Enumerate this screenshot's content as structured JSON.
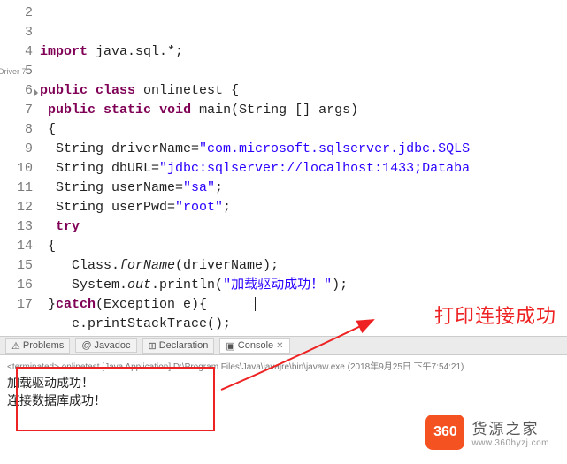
{
  "gutter": {
    "lines": [
      "2",
      "3",
      "4",
      "5",
      "6",
      "7",
      "8",
      "9",
      "10",
      "11",
      "12",
      "13",
      "14",
      "15",
      "16",
      "17"
    ],
    "override_marker": "6"
  },
  "left_label": "Driver 7",
  "code": {
    "l3_kw": "import",
    "l3_rest": " java.sql.*;",
    "l5_kw1": "public",
    "l5_kw2": "class",
    "l5_rest": " onlinetest {",
    "l6_kw1": "public",
    "l6_kw2": "static",
    "l6_kw3": "void",
    "l6_rest": " main(String [] args)",
    "l7": " {",
    "l8a": "  String driverName=",
    "l8b": "\"com.microsoft.sqlserver.jdbc.SQLS",
    "l9a": "  String dbURL=",
    "l9b": "\"jdbc:sqlserver://localhost:1433;Databa",
    "l10a": "  String userName=",
    "l10b": "\"sa\"",
    "l10c": ";",
    "l11a": "  String userPwd=",
    "l11b": "\"root\"",
    "l11c": ";",
    "l12_kw": "try",
    "l13": " {",
    "l14a": "    Class.",
    "l14b": "forName",
    "l14c": "(driverName);",
    "l15a": "    System.",
    "l15b": "out",
    "l15c": ".println(",
    "l15d": "\"加载驱动成功！\"",
    "l15e": ");",
    "l16a": " }",
    "l16_kw": "catch",
    "l16c": "(Exception e){",
    "l17": "    e.printStackTrace();"
  },
  "tabs": {
    "problems": "Problems",
    "javadoc": "Javadoc",
    "declaration": "Declaration",
    "console": "Console"
  },
  "console": {
    "header": "<terminated> onlinetest [Java Application] D:\\Program Files\\Java\\javajre\\bin\\javaw.exe (2018年9月25日 下午7:54:21)",
    "line1": "加载驱动成功！",
    "line2": "连接数据库成功！"
  },
  "annotation": "打印连接成功",
  "logo": {
    "badge": "360",
    "cn": "货源之家",
    "url": "www.360hyzj.com"
  }
}
